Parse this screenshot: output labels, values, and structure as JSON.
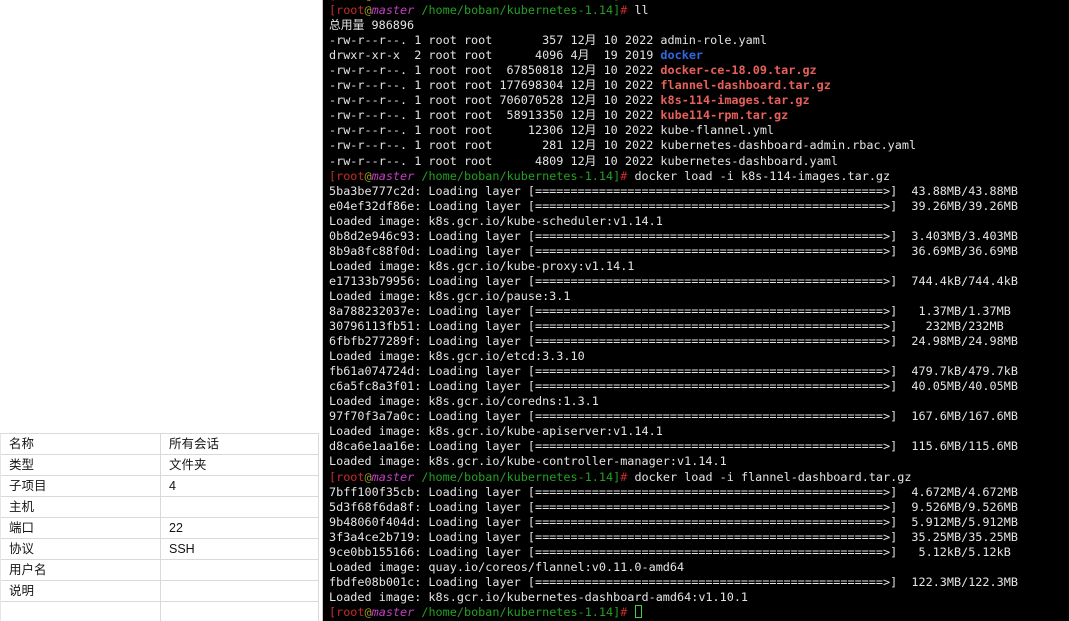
{
  "left_panel": {
    "rows": [
      {
        "label": "名称",
        "value": "所有会话"
      },
      {
        "label": "类型",
        "value": "文件夹"
      },
      {
        "label": "子项目",
        "value": "4"
      },
      {
        "label": "主机",
        "value": ""
      },
      {
        "label": "端口",
        "value": "22"
      },
      {
        "label": "协议",
        "value": "SSH"
      },
      {
        "label": "用户名",
        "value": ""
      },
      {
        "label": "说明",
        "value": ""
      },
      {
        "label": "",
        "value": ""
      }
    ]
  },
  "terminal": {
    "background": "#000000",
    "styles": {
      "d": {
        "color": "#e4e4e4"
      },
      "r": {
        "color": "#c72c2c"
      },
      "R": {
        "color": "#e8605a",
        "fontWeight": "bold"
      },
      "g": {
        "color": "#23a123"
      },
      "m": {
        "color": "#c23fc2",
        "fontStyle": "italic"
      },
      "y": {
        "color": "#9d9b1e"
      },
      "b": {
        "color": "#3168e0",
        "fontWeight": "bold"
      },
      "cursor": {
        "color": "#3ecf3e"
      }
    },
    "prompt": [
      {
        "t": "[root",
        "c": "r"
      },
      {
        "t": "@",
        "c": "y"
      },
      {
        "t": "master",
        "c": "m"
      },
      {
        "t": " /home/boban/kubernetes-1.14]",
        "c": "g"
      },
      {
        "t": "# ",
        "c": "r"
      }
    ],
    "bar": {
      "label": ": Loading layer ",
      "open": "[",
      "fill": "=",
      "fill_count": 49,
      "arrow": ">",
      "close": "]"
    },
    "lines": [
      {
        "type": "prompt",
        "cmd": "",
        "sliver": true
      },
      {
        "type": "prompt",
        "cmd": "ll"
      },
      {
        "type": "seg",
        "segs": [
          {
            "t": "总用量 986896",
            "c": "d"
          }
        ]
      },
      {
        "type": "seg",
        "segs": [
          {
            "t": "-rw-r--r--. 1 root root       357 12月 10 2022 admin-role.yaml",
            "c": "d"
          }
        ]
      },
      {
        "type": "seg",
        "segs": [
          {
            "t": "drwxr-xr-x  2 root root      4096 4月  19 2019 ",
            "c": "d"
          },
          {
            "t": "docker",
            "c": "b"
          }
        ]
      },
      {
        "type": "seg",
        "segs": [
          {
            "t": "-rw-r--r--. 1 root root  67850818 12月 10 2022 ",
            "c": "d"
          },
          {
            "t": "docker-ce-18.09.tar.gz",
            "c": "R"
          }
        ]
      },
      {
        "type": "seg",
        "segs": [
          {
            "t": "-rw-r--r--. 1 root root 177698304 12月 10 2022 ",
            "c": "d"
          },
          {
            "t": "flannel-dashboard.tar.gz",
            "c": "R"
          }
        ]
      },
      {
        "type": "seg",
        "segs": [
          {
            "t": "-rw-r--r--. 1 root root 706070528 12月 10 2022 ",
            "c": "d"
          },
          {
            "t": "k8s-114-images.tar.gz",
            "c": "R"
          }
        ]
      },
      {
        "type": "seg",
        "segs": [
          {
            "t": "-rw-r--r--. 1 root root  58913350 12月 10 2022 ",
            "c": "d"
          },
          {
            "t": "kube114-rpm.tar.gz",
            "c": "R"
          }
        ]
      },
      {
        "type": "seg",
        "segs": [
          {
            "t": "-rw-r--r--. 1 root root     12306 12月 10 2022 kube-flannel.yml",
            "c": "d"
          }
        ]
      },
      {
        "type": "seg",
        "segs": [
          {
            "t": "-rw-r--r--. 1 root root       281 12月 10 2022 kubernetes-dashboard-admin.rbac.yaml",
            "c": "d"
          }
        ]
      },
      {
        "type": "seg",
        "segs": [
          {
            "t": "-rw-r--r--. 1 root root      4809 12月 10 2022 kubernetes-dashboard.yaml",
            "c": "d"
          }
        ]
      },
      {
        "type": "prompt",
        "cmd": "docker load -i k8s-114-images.tar.gz"
      },
      {
        "type": "bar",
        "id": "5ba3be777c2d",
        "size": "  43.88MB/43.88MB"
      },
      {
        "type": "bar",
        "id": "e04ef32df86e",
        "size": "  39.26MB/39.26MB"
      },
      {
        "type": "seg",
        "segs": [
          {
            "t": "Loaded image: k8s.gcr.io/kube-scheduler:v1.14.1",
            "c": "d"
          }
        ]
      },
      {
        "type": "bar",
        "id": "0b8d2e946c93",
        "size": "  3.403MB/3.403MB"
      },
      {
        "type": "bar",
        "id": "8b9a8fc88f0d",
        "size": "  36.69MB/36.69MB"
      },
      {
        "type": "seg",
        "segs": [
          {
            "t": "Loaded image: k8s.gcr.io/kube-proxy:v1.14.1",
            "c": "d"
          }
        ]
      },
      {
        "type": "bar",
        "id": "e17133b79956",
        "size": "  744.4kB/744.4kB"
      },
      {
        "type": "seg",
        "segs": [
          {
            "t": "Loaded image: k8s.gcr.io/pause:3.1",
            "c": "d"
          }
        ]
      },
      {
        "type": "bar",
        "id": "8a788232037e",
        "size": "   1.37MB/1.37MB"
      },
      {
        "type": "bar",
        "id": "30796113fb51",
        "size": "    232MB/232MB"
      },
      {
        "type": "bar",
        "id": "6fbfb277289f",
        "size": "  24.98MB/24.98MB"
      },
      {
        "type": "seg",
        "segs": [
          {
            "t": "Loaded image: k8s.gcr.io/etcd:3.3.10",
            "c": "d"
          }
        ]
      },
      {
        "type": "bar",
        "id": "fb61a074724d",
        "size": "  479.7kB/479.7kB"
      },
      {
        "type": "bar",
        "id": "c6a5fc8a3f01",
        "size": "  40.05MB/40.05MB"
      },
      {
        "type": "seg",
        "segs": [
          {
            "t": "Loaded image: k8s.gcr.io/coredns:1.3.1",
            "c": "d"
          }
        ]
      },
      {
        "type": "bar",
        "id": "97f70f3a7a0c",
        "size": "  167.6MB/167.6MB"
      },
      {
        "type": "seg",
        "segs": [
          {
            "t": "Loaded image: k8s.gcr.io/kube-apiserver:v1.14.1",
            "c": "d"
          }
        ]
      },
      {
        "type": "bar",
        "id": "d8ca6e1aa16e",
        "size": "  115.6MB/115.6MB"
      },
      {
        "type": "seg",
        "segs": [
          {
            "t": "Loaded image: k8s.gcr.io/kube-controller-manager:v1.14.1",
            "c": "d"
          }
        ]
      },
      {
        "type": "prompt",
        "cmd": "docker load -i flannel-dashboard.tar.gz"
      },
      {
        "type": "bar",
        "id": "7bff100f35cb",
        "size": "  4.672MB/4.672MB"
      },
      {
        "type": "bar",
        "id": "5d3f68f6da8f",
        "size": "  9.526MB/9.526MB"
      },
      {
        "type": "bar",
        "id": "9b48060f404d",
        "size": "  5.912MB/5.912MB"
      },
      {
        "type": "bar",
        "id": "3f3a4ce2b719",
        "size": "  35.25MB/35.25MB"
      },
      {
        "type": "bar",
        "id": "9ce0bb155166",
        "size": "   5.12kB/5.12kB"
      },
      {
        "type": "seg",
        "segs": [
          {
            "t": "Loaded image: quay.io/coreos/flannel:v0.11.0-amd64",
            "c": "d"
          }
        ]
      },
      {
        "type": "bar",
        "id": "fbdfe08b001c",
        "size": "  122.3MB/122.3MB"
      },
      {
        "type": "seg",
        "segs": [
          {
            "t": "Loaded image: k8s.gcr.io/kubernetes-dashboard-amd64:v1.10.1",
            "c": "d"
          }
        ]
      },
      {
        "type": "prompt",
        "cmd": "",
        "cursor": true
      }
    ]
  }
}
